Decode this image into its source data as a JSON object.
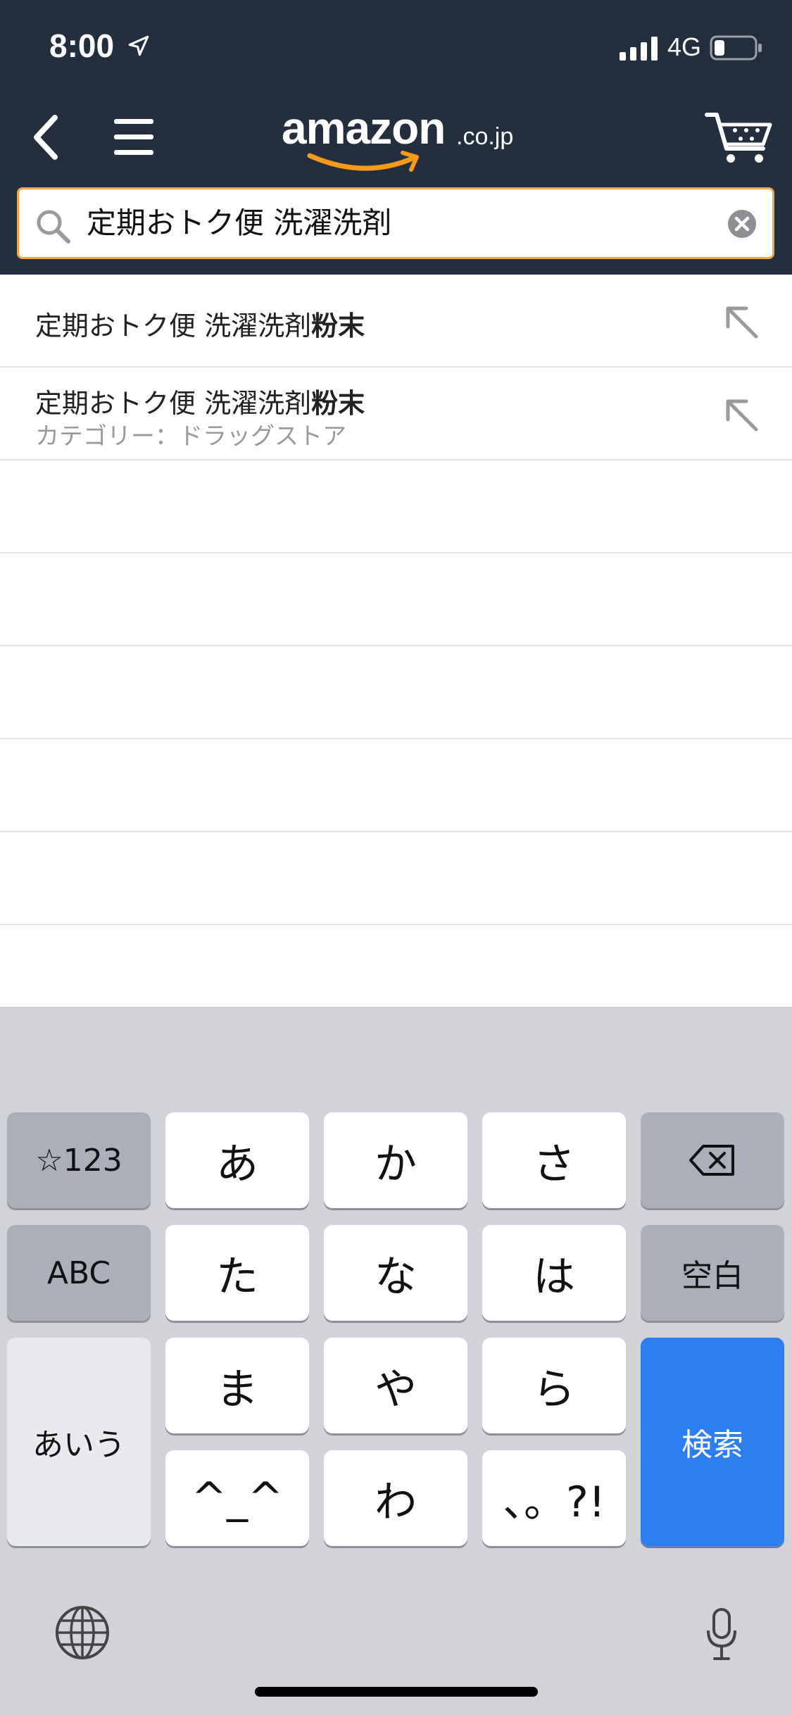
{
  "status_bar": {
    "time": "8:00",
    "network": "4G"
  },
  "nav": {
    "logo_main": "amazon",
    "logo_suffix": ".co.jp",
    "icons": [
      "back-icon",
      "menu-icon",
      "cart-icon"
    ]
  },
  "search": {
    "query": "定期おトク便 洗濯洗剤",
    "accent_color": "#f0a64b"
  },
  "suggestions": [
    {
      "prefix": "定期おトク便 洗濯洗剤",
      "bold": "粉末",
      "category": ""
    },
    {
      "prefix": "定期おトク便 洗濯洗剤",
      "bold": "粉末",
      "category": "カテゴリー：ドラッグストア"
    }
  ],
  "keyboard": {
    "row1": [
      "☆123",
      "あ",
      "か",
      "さ"
    ],
    "row2": [
      "ABC",
      "た",
      "な",
      "は",
      "空白"
    ],
    "row3": [
      "ま",
      "や",
      "ら"
    ],
    "row4": [
      "^_^",
      "わ",
      "、。?!"
    ],
    "left_tall": "あいう",
    "search_key": "検索",
    "search_color": "#2d7ef3"
  },
  "colors": {
    "header_bg": "#232f3e",
    "logo_smile": "#f79a1a"
  }
}
